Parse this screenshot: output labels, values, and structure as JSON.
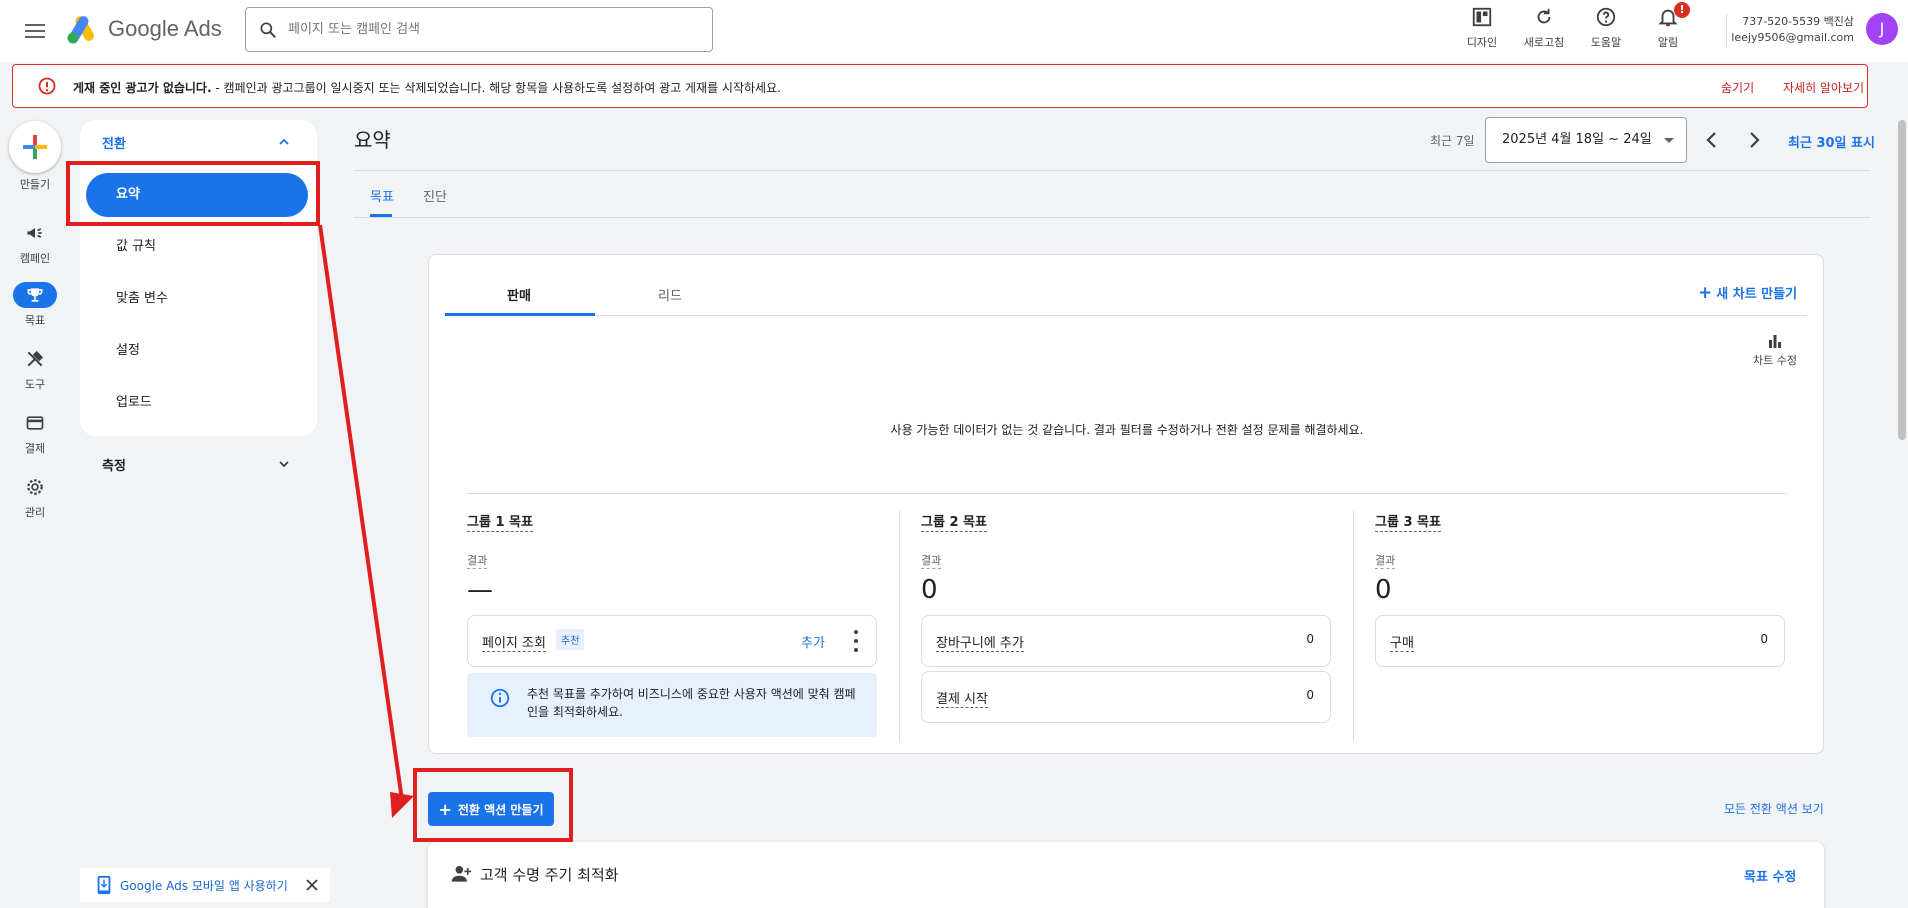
{
  "header": {
    "app_name": "Google Ads",
    "search_placeholder": "페이지 또는 캠페인 검색",
    "actions": [
      {
        "label": "디자인"
      },
      {
        "label": "새로고침"
      },
      {
        "label": "도움말"
      },
      {
        "label": "알림",
        "badge": "!"
      }
    ],
    "account_id": "737-520-5539 백진삼",
    "account_email": "leejy9506@gmail.com",
    "avatar_letter": "J"
  },
  "alert": {
    "title": "게재 중인 광고가 없습니다.",
    "message": " - 캠페인과 광고그룹이 일시중지 또는 삭제되었습니다. 해당 항목을 사용하도록 설정하여 광고 게재를 시작하세요.",
    "hide_label": "숨기기",
    "learn_more_label": "자세히 알아보기"
  },
  "rail": {
    "create_label": "만들기",
    "items": [
      {
        "label": "캠페인",
        "icon": "megaphone-icon"
      },
      {
        "label": "목표",
        "icon": "trophy-icon",
        "active": true
      },
      {
        "label": "도구",
        "icon": "tools-icon"
      },
      {
        "label": "결제",
        "icon": "credit-card-icon"
      },
      {
        "label": "관리",
        "icon": "gear-icon"
      }
    ]
  },
  "subnav": {
    "section_title": "전환",
    "items": [
      "요약",
      "값 규칙",
      "맞춤 변수",
      "설정",
      "업로드"
    ],
    "active_item": "요약",
    "measure_title": "측정",
    "app_promo": "Google Ads 모바일 앱 사용하기"
  },
  "main": {
    "title": "요약",
    "date_label": "최근 7일",
    "date_range": "2025년 4월 18일 ~ 24일",
    "last30_label": "최근 30일 표시",
    "tabs": [
      "목표",
      "진단"
    ],
    "active_tab": "목표"
  },
  "card": {
    "tabs": [
      "판매",
      "리드"
    ],
    "active_tab": "판매",
    "new_chart_label": "새 차트 만들기",
    "edit_chart_label": "차트 수정",
    "no_data_message": "사용 가능한 데이터가 없는 것 같습니다. 결과 필터를 수정하거나 전환 설정 문제를 해결하세요.",
    "groups": [
      {
        "title": "그룹 1 목표",
        "sub": "결과",
        "value": "—",
        "goals": [
          {
            "name": "페이지 조회",
            "chip": "추천",
            "add_label": "추가"
          }
        ],
        "info": "추천 목표를 추가하여 비즈니스에 중요한 사용자 액션에 맞춰 캠페인을 최적화하세요."
      },
      {
        "title": "그룹 2 목표",
        "sub": "결과",
        "value": "0",
        "goals": [
          {
            "name": "장바구니에 추가",
            "count": "0"
          },
          {
            "name": "결제 시작",
            "count": "0"
          }
        ]
      },
      {
        "title": "그룹 3 목표",
        "sub": "결과",
        "value": "0",
        "goals": [
          {
            "name": "구매",
            "count": "0"
          }
        ]
      }
    ]
  },
  "bottom": {
    "create_button": "전환 액션 만들기",
    "all_actions_link": "모든 전환 액션 보기",
    "lifecycle_title": "고객 수명 주기 최적화",
    "lifecycle_edit": "목표 수정"
  },
  "colors": {
    "accent": "#1a73e8",
    "alert_red": "#d93025",
    "annotation_red": "#e02020"
  }
}
